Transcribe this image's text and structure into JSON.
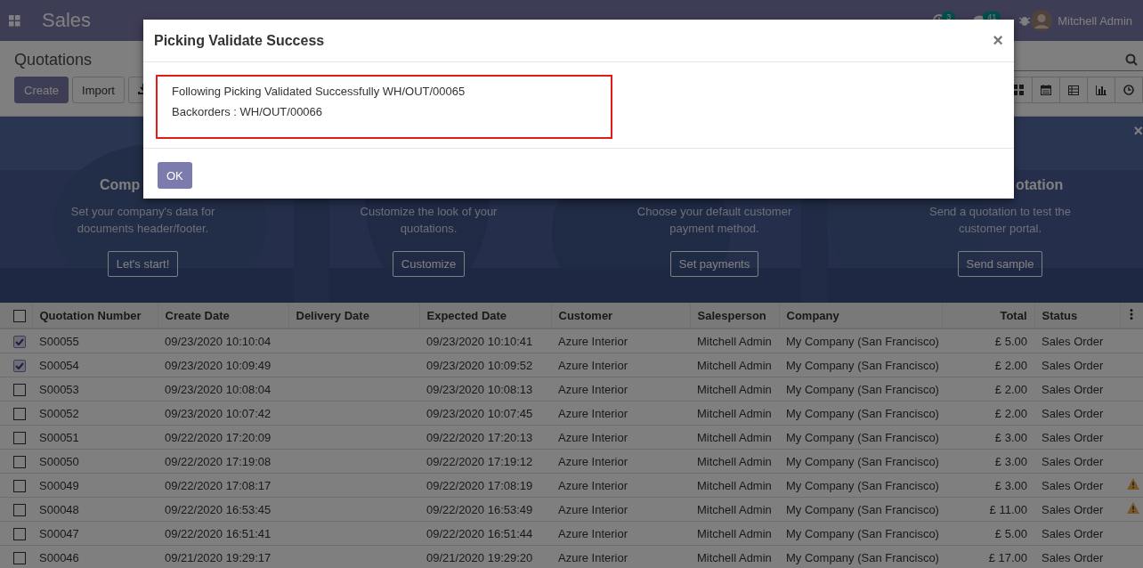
{
  "navbar": {
    "app_name": "Sales",
    "activity_count": "3",
    "message_count": "41",
    "user": "Mitchell Admin"
  },
  "control_panel": {
    "breadcrumb": "Quotations",
    "buttons": [
      {
        "label": "Create",
        "kind": "primary"
      },
      {
        "label": "Import",
        "kind": "secondary"
      }
    ]
  },
  "banner": {
    "close": "×",
    "cards": [
      {
        "title": "Comp",
        "lines": [
          "Set your company's data for",
          "documents header/footer."
        ],
        "button": "Let's start!"
      },
      {
        "lines": [
          "Customize the look of your",
          "quotations."
        ],
        "button": "Customize"
      },
      {
        "lines": [
          "Choose your default customer",
          "payment method."
        ],
        "button": "Set payments"
      },
      {
        "title": "otation",
        "lines": [
          "Send a quotation to test the",
          "customer portal."
        ],
        "button": "Send sample"
      }
    ]
  },
  "table": {
    "all_selected": false,
    "columns": [
      {
        "label": "Quotation Number",
        "kind": "text"
      },
      {
        "label": "Create Date",
        "kind": "text"
      },
      {
        "label": "Delivery Date",
        "kind": "text"
      },
      {
        "label": "Expected Date",
        "kind": "text"
      },
      {
        "label": "Customer",
        "kind": "text"
      },
      {
        "label": "Salesperson",
        "kind": "text"
      },
      {
        "label": "Company",
        "kind": "text"
      },
      {
        "label": "Total",
        "kind": "amount"
      },
      {
        "label": "Status",
        "kind": "text"
      }
    ],
    "rows": [
      {
        "selected": true,
        "warning": false,
        "cells": [
          "S00055",
          "09/23/2020 10:10:04",
          "",
          "09/23/2020 10:10:41",
          "Azure Interior",
          "Mitchell Admin",
          "My Company (San Francisco)",
          "£ 5.00",
          "Sales Order"
        ]
      },
      {
        "selected": true,
        "warning": false,
        "cells": [
          "S00054",
          "09/23/2020 10:09:49",
          "",
          "09/23/2020 10:09:52",
          "Azure Interior",
          "Mitchell Admin",
          "My Company (San Francisco)",
          "£ 2.00",
          "Sales Order"
        ]
      },
      {
        "selected": false,
        "warning": false,
        "cells": [
          "S00053",
          "09/23/2020 10:08:04",
          "",
          "09/23/2020 10:08:13",
          "Azure Interior",
          "Mitchell Admin",
          "My Company (San Francisco)",
          "£ 2.00",
          "Sales Order"
        ]
      },
      {
        "selected": false,
        "warning": false,
        "cells": [
          "S00052",
          "09/23/2020 10:07:42",
          "",
          "09/23/2020 10:07:45",
          "Azure Interior",
          "Mitchell Admin",
          "My Company (San Francisco)",
          "£ 2.00",
          "Sales Order"
        ]
      },
      {
        "selected": false,
        "warning": false,
        "cells": [
          "S00051",
          "09/22/2020 17:20:09",
          "",
          "09/22/2020 17:20:13",
          "Azure Interior",
          "Mitchell Admin",
          "My Company (San Francisco)",
          "£ 3.00",
          "Sales Order"
        ]
      },
      {
        "selected": false,
        "warning": false,
        "cells": [
          "S00050",
          "09/22/2020 17:19:08",
          "",
          "09/22/2020 17:19:12",
          "Azure Interior",
          "Mitchell Admin",
          "My Company (San Francisco)",
          "£ 3.00",
          "Sales Order"
        ]
      },
      {
        "selected": false,
        "warning": true,
        "cells": [
          "S00049",
          "09/22/2020 17:08:17",
          "",
          "09/22/2020 17:08:19",
          "Azure Interior",
          "Mitchell Admin",
          "My Company (San Francisco)",
          "£ 3.00",
          "Sales Order"
        ]
      },
      {
        "selected": false,
        "warning": true,
        "cells": [
          "S00048",
          "09/22/2020 16:53:45",
          "",
          "09/22/2020 16:53:49",
          "Azure Interior",
          "Mitchell Admin",
          "My Company (San Francisco)",
          "£ 11.00",
          "Sales Order"
        ]
      },
      {
        "selected": false,
        "warning": false,
        "cells": [
          "S00047",
          "09/22/2020 16:51:41",
          "",
          "09/22/2020 16:51:44",
          "Azure Interior",
          "Mitchell Admin",
          "My Company (San Francisco)",
          "£ 5.00",
          "Sales Order"
        ]
      },
      {
        "selected": false,
        "warning": false,
        "cells": [
          "S00046",
          "09/21/2020 19:29:17",
          "",
          "09/21/2020 19:29:20",
          "Azure Interior",
          "Mitchell Admin",
          "My Company (San Francisco)",
          "£ 17.00",
          "Sales Order"
        ]
      }
    ]
  },
  "dialog": {
    "title": "Picking Validate Success",
    "close": "×",
    "lines": [
      "Following Picking Validated Successfully WH/OUT/00065",
      "Backorders : WH/OUT/00066"
    ],
    "button": "OK"
  }
}
